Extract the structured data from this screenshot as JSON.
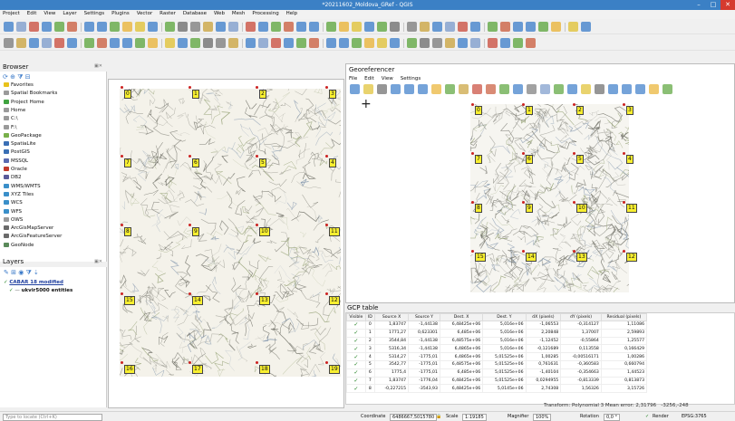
{
  "window": {
    "title": "*20211602_Moldova_GRef - QGIS"
  },
  "menubar": [
    "Project",
    "Edit",
    "View",
    "Layer",
    "Settings",
    "Plugins",
    "Vector",
    "Raster",
    "Database",
    "Web",
    "Mesh",
    "Processing",
    "Help"
  ],
  "browser": {
    "title": "Browser",
    "items": [
      {
        "label": "Favorites",
        "icon": "star-icon",
        "color": "#e8c21b"
      },
      {
        "label": "Spatial Bookmarks",
        "icon": "bookmark-icon",
        "color": "#9a9a9a"
      },
      {
        "label": "Project Home",
        "icon": "folder-icon",
        "color": "#3fa33f"
      },
      {
        "label": "Home",
        "icon": "folder-icon",
        "color": "#9a9a9a"
      },
      {
        "label": "C:\\",
        "icon": "drive-icon",
        "color": "#9a9a9a"
      },
      {
        "label": "F:\\",
        "icon": "drive-icon",
        "color": "#9a9a9a"
      },
      {
        "label": "GeoPackage",
        "icon": "geopackage-icon",
        "color": "#78b04a"
      },
      {
        "label": "SpatiaLite",
        "icon": "spatialite-icon",
        "color": "#3a6fb5"
      },
      {
        "label": "PostGIS",
        "icon": "postgis-icon",
        "color": "#3a6fb5"
      },
      {
        "label": "MSSQL",
        "icon": "mssql-icon",
        "color": "#5a6ab0"
      },
      {
        "label": "Oracle",
        "icon": "oracle-icon",
        "color": "#c23a2a"
      },
      {
        "label": "DB2",
        "icon": "db2-icon",
        "color": "#5a5a9a"
      },
      {
        "label": "WMS/WMTS",
        "icon": "globe-icon",
        "color": "#3a8fc9"
      },
      {
        "label": "XYZ Tiles",
        "icon": "tiles-icon",
        "color": "#3a8fc9"
      },
      {
        "label": "WCS",
        "icon": "globe-icon",
        "color": "#3a8fc9"
      },
      {
        "label": "WFS",
        "icon": "globe-icon",
        "color": "#3a8fc9"
      },
      {
        "label": "OWS",
        "icon": "globe-icon",
        "color": "#9a9a9a"
      },
      {
        "label": "ArcGisMapServer",
        "icon": "arcgis-icon",
        "color": "#6a6a6a"
      },
      {
        "label": "ArcGisFeatureServer",
        "icon": "arcgis-icon",
        "color": "#6a6a6a"
      },
      {
        "label": "GeoNode",
        "icon": "geonode-icon",
        "color": "#5a8a5a"
      }
    ]
  },
  "layers": {
    "title": "Layers",
    "items": [
      {
        "label": "CABAR 18 modified",
        "checked": true
      },
      {
        "label": "ukvir5000 entities",
        "checked": true
      }
    ]
  },
  "map": {
    "gcps": [
      "0",
      "1",
      "2",
      "3",
      "7",
      "6",
      "5",
      "4",
      "8",
      "9",
      "10",
      "11",
      "15",
      "14",
      "13",
      "12",
      "16",
      "17",
      "18",
      "19"
    ]
  },
  "georeferencer": {
    "title": "Georeferencer",
    "menu": [
      "File",
      "Edit",
      "View",
      "Settings"
    ],
    "gcps": [
      "0",
      "1",
      "2",
      "3",
      "7",
      "6",
      "5",
      "4",
      "8",
      "9",
      "10",
      "11",
      "15",
      "14",
      "13",
      "12"
    ]
  },
  "gcp_table": {
    "title": "GCP table",
    "columns": [
      "Visible",
      "ID",
      "Source X",
      "Source Y",
      "Dest. X",
      "Dest. Y",
      "dX (pixels)",
      "dY (pixels)",
      "Residual (pixels)"
    ],
    "rows": [
      [
        "0",
        "1,83747",
        "-1,44138",
        "6,48425e+06",
        "5,016e+06",
        "-1,06553",
        "-0,314127",
        "1,11086"
      ],
      [
        "1",
        "1771,27",
        "0,623301",
        "6,485e+06",
        "5,016e+06",
        "2,20848",
        "1,37007",
        "2,59893"
      ],
      [
        "2",
        "3544,84",
        "-1,44138",
        "6,48575e+06",
        "5,016e+06",
        "-1,12452",
        "-0,55864",
        "1,25577"
      ],
      [
        "3",
        "5316,34",
        "-1,44138",
        "6,4865e+06",
        "5,016e+06",
        "-0,121689",
        "0,113558",
        "0,166429"
      ],
      [
        "4",
        "5314,27",
        "-1775,01",
        "6,4865e+06",
        "5,01525e+06",
        "1,00285",
        "-0,00516171",
        "1,00286"
      ],
      [
        "5",
        "3542,77",
        "-1775,01",
        "6,48575e+06",
        "5,01525e+06",
        "0,761631",
        "-0,360583",
        "0,660794"
      ],
      [
        "6",
        "1775,4",
        "-1775,01",
        "6,485e+06",
        "5,01525e+06",
        "-1,40104",
        "-0,354663",
        "1,44523"
      ],
      [
        "7",
        "1,83747",
        "-1776,04",
        "6,48425e+06",
        "5,01525e+06",
        "0,0294955",
        "-0,813339",
        "0,813873"
      ],
      [
        "8",
        "-0,227215",
        "-3543,93",
        "6,48425e+06",
        "5,0145e+06",
        "2,74308",
        "1,56326",
        "3,15726"
      ]
    ],
    "transform": "Transform: Polynomial 3 Mean error: 2,31796",
    "extra": "-3256,-248"
  },
  "statusbar": {
    "locate_placeholder": "Type to locate (Ctrl+K)",
    "coordinate_label": "Coordinate",
    "coordinate": "6486667,5015780",
    "scale_label": "Scale",
    "scale": "1:19185",
    "magnifier_label": "Magnifier",
    "magnifier": "100%",
    "rotation_label": "Rotation",
    "rotation": "0,0 °",
    "render_label": "Render",
    "crs": "EPSG:3765"
  },
  "colors": {
    "titlebar": "#3b80c5",
    "gcp_label": "#f8ef30",
    "gcp_point": "#cc2222"
  }
}
